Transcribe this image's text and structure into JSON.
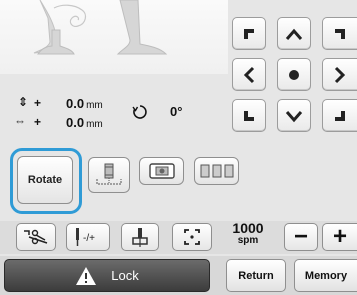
{
  "status": {
    "vertical_offset_value": "0.0",
    "horizontal_offset_value": "0.0",
    "offset_unit": "mm",
    "rotation_value": "0°",
    "plus_sign": "+"
  },
  "buttons": {
    "rotate_label": "Rotate",
    "lock_label": "Lock",
    "return_label": "Return",
    "memory_label": "Memory"
  },
  "speed": {
    "value": "1000",
    "unit": "spm",
    "minus_label": "−",
    "plus_label": "+"
  },
  "icons": {
    "arrow_pad": [
      "arrow-up-left-icon",
      "arrow-up-icon",
      "arrow-up-right-icon",
      "arrow-left-icon",
      "center-icon",
      "arrow-right-icon",
      "arrow-down-left-icon",
      "arrow-down-icon",
      "arrow-down-right-icon"
    ],
    "function_row": [
      "thread-spool-preview-icon",
      "embroidery-frame-icon",
      "multi-spool-icon"
    ],
    "tool_row": [
      "cut-thread-icon",
      "needle-position-icon",
      "presser-foot-icon",
      "trial-area-icon"
    ]
  },
  "colors": {
    "highlight": "#2f9bd6",
    "lock_button": "#4a4a4a"
  }
}
